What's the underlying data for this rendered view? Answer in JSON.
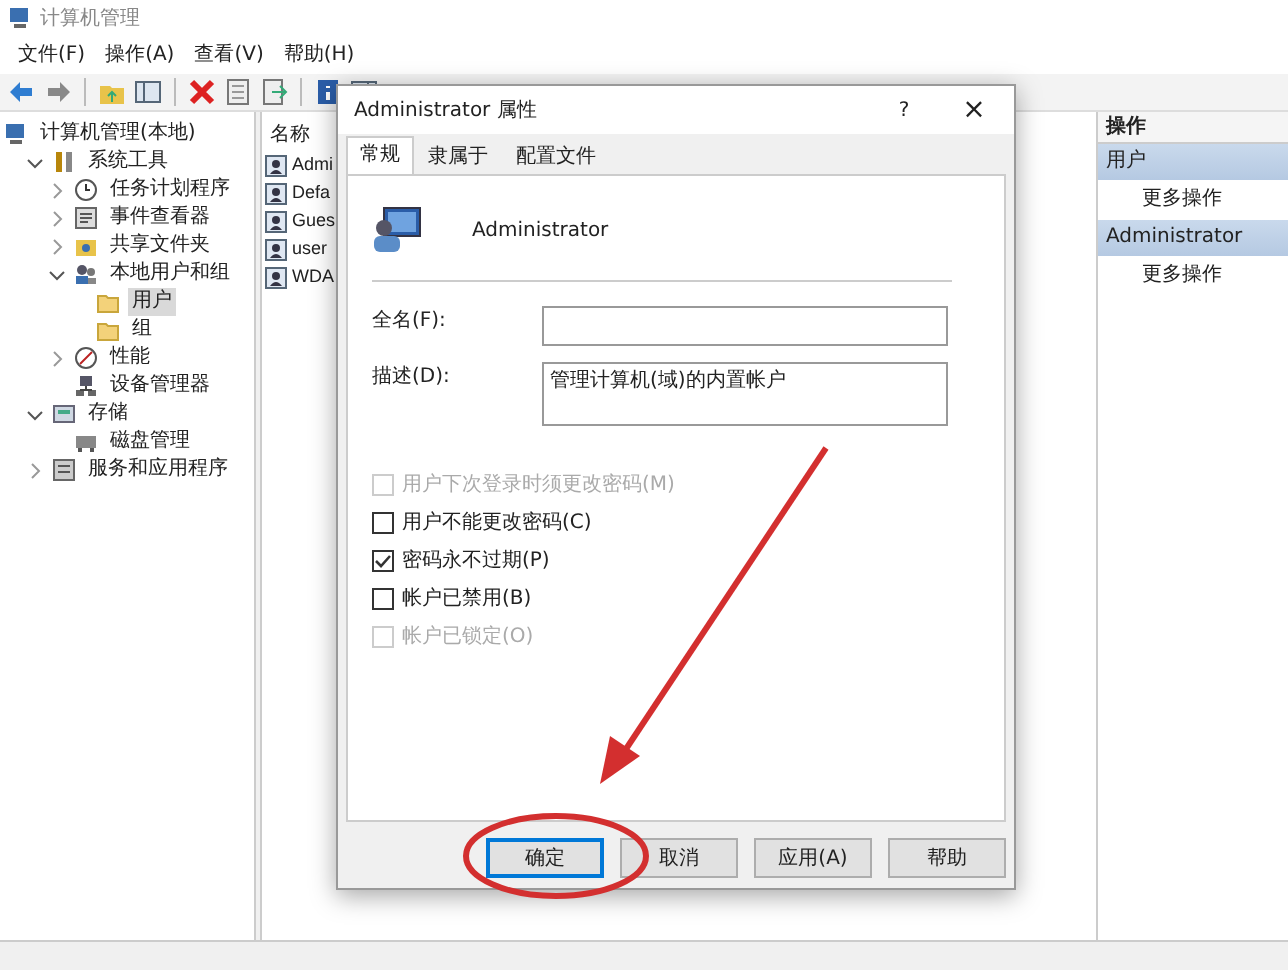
{
  "window": {
    "title": "计算机管理"
  },
  "menu": [
    "文件(F)",
    "操作(A)",
    "查看(V)",
    "帮助(H)"
  ],
  "tree": [
    {
      "label": "计算机管理(本地)",
      "selected": false,
      "children": [
        {
          "label": "系统工具",
          "selected": false,
          "expanded": true,
          "children": [
            {
              "label": "任务计划程序",
              "selected": false,
              "expanded": false
            },
            {
              "label": "事件查看器",
              "selected": false,
              "expanded": false
            },
            {
              "label": "共享文件夹",
              "selected": false,
              "expanded": false
            },
            {
              "label": "本地用户和组",
              "selected": false,
              "expanded": true,
              "children": [
                {
                  "label": "用户",
                  "selected": true
                },
                {
                  "label": "组",
                  "selected": false
                }
              ]
            },
            {
              "label": "性能",
              "selected": false,
              "expanded": false
            },
            {
              "label": "设备管理器",
              "selected": false
            }
          ]
        },
        {
          "label": "存储",
          "selected": false,
          "expanded": true,
          "children": [
            {
              "label": "磁盘管理",
              "selected": false
            }
          ]
        },
        {
          "label": "服务和应用程序",
          "selected": false,
          "expanded": false
        }
      ]
    }
  ],
  "list": {
    "column": "名称",
    "rows": [
      "Admi",
      "Defa",
      "Gues",
      "user",
      "WDA"
    ]
  },
  "actions": {
    "title": "操作",
    "sections": [
      {
        "label": "用户",
        "items": [
          "更多操作"
        ]
      },
      {
        "label": "Administrator",
        "items": [
          "更多操作"
        ]
      }
    ]
  },
  "dialog": {
    "title": "Administrator 属性",
    "help": "?",
    "close": "×",
    "tabs": [
      {
        "label": "常规",
        "selected": true
      },
      {
        "label": "隶属于",
        "selected": false
      },
      {
        "label": "配置文件",
        "selected": false
      }
    ],
    "user_name": "Administrator",
    "fields": [
      {
        "label": "全名(F):"
      },
      {
        "label": "描述(D):",
        "value": "管理计算机(域)的内置帐户"
      }
    ],
    "options": [
      {
        "label": "用户下次登录时须更改密码(M)",
        "checked": false,
        "disabled": true
      },
      {
        "label": "用户不能更改密码(C)",
        "checked": false,
        "disabled": false
      },
      {
        "label": "密码永不过期(P)",
        "checked": true,
        "disabled": false
      },
      {
        "label": "帐户已禁用(B)",
        "checked": false,
        "disabled": false
      },
      {
        "label": "帐户已锁定(O)",
        "checked": false,
        "disabled": true
      }
    ],
    "buttons": [
      {
        "label": "确定",
        "default": true
      },
      {
        "label": "取消",
        "default": false
      },
      {
        "label": "应用(A)",
        "default": false
      },
      {
        "label": "帮助",
        "default": false
      }
    ]
  }
}
